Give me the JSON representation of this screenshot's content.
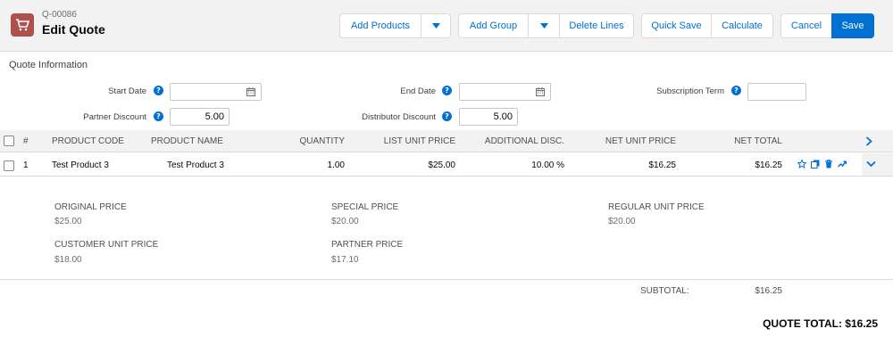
{
  "header": {
    "record_id": "Q-00086",
    "title": "Edit Quote",
    "buttons": {
      "add_products": "Add Products",
      "add_group": "Add Group",
      "delete_lines": "Delete Lines",
      "quick_save": "Quick Save",
      "calculate": "Calculate",
      "cancel": "Cancel",
      "save": "Save"
    }
  },
  "quote_info": {
    "section_title": "Quote Information",
    "start_date": {
      "label": "Start Date",
      "value": ""
    },
    "end_date": {
      "label": "End Date",
      "value": ""
    },
    "subscription_term": {
      "label": "Subscription Term",
      "value": ""
    },
    "partner_discount": {
      "label": "Partner Discount",
      "value": "5.00"
    },
    "distributor_discount": {
      "label": "Distributor Discount",
      "value": "5.00"
    }
  },
  "table": {
    "columns": {
      "num": "#",
      "product_code": "PRODUCT CODE",
      "product_name": "PRODUCT NAME",
      "quantity": "QUANTITY",
      "list_unit_price": "LIST UNIT PRICE",
      "additional_disc": "ADDITIONAL DISC.",
      "net_unit_price": "NET UNIT PRICE",
      "net_total": "NET TOTAL"
    },
    "rows": [
      {
        "num": "1",
        "product_code": "Test Product 3",
        "product_name": "Test Product 3",
        "quantity": "1.00",
        "list_unit_price": "$25.00",
        "additional_disc": "10.00 %",
        "net_unit_price": "$16.25",
        "net_total": "$16.25"
      }
    ]
  },
  "details": {
    "original_price": {
      "label": "ORIGINAL PRICE",
      "value": "$25.00"
    },
    "special_price": {
      "label": "SPECIAL PRICE",
      "value": "$20.00"
    },
    "regular_unit_price": {
      "label": "REGULAR UNIT PRICE",
      "value": "$20.00"
    },
    "customer_unit_price": {
      "label": "CUSTOMER UNIT PRICE",
      "value": "$18.00"
    },
    "partner_price": {
      "label": "PARTNER PRICE",
      "value": "$17.10"
    }
  },
  "totals": {
    "subtotal_label": "SUBTOTAL:",
    "subtotal_value": "$16.25",
    "quote_total": "QUOTE TOTAL: $16.25"
  },
  "colors": {
    "brand_blue": "#0070d2",
    "app_icon": "#b0504d",
    "header_bg": "#f3f2f2"
  },
  "icons": [
    "cart-icon",
    "calendar-icon",
    "help-icon",
    "caret-down-icon",
    "chevron-right-icon",
    "chevron-down-icon",
    "star-icon",
    "clone-icon",
    "trash-icon",
    "trend-icon"
  ]
}
